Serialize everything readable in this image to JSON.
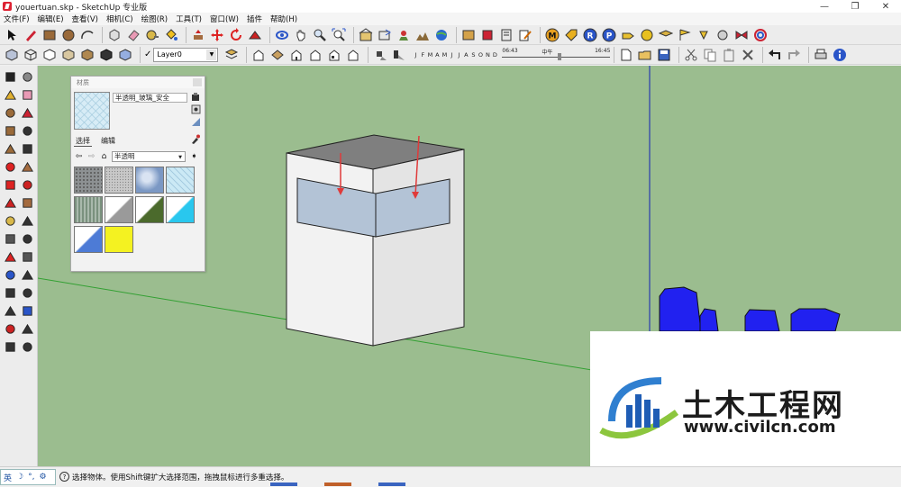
{
  "window": {
    "title": "youertuan.skp - SketchUp 专业版",
    "minimize": "—",
    "maximize": "❐",
    "close": "✕"
  },
  "menu": [
    "文件(F)",
    "编辑(E)",
    "查看(V)",
    "相机(C)",
    "绘图(R)",
    "工具(T)",
    "窗口(W)",
    "插件",
    "帮助(H)"
  ],
  "layers": {
    "check": "✓",
    "current": "Layer0"
  },
  "shadow": {
    "months": [
      "J",
      "F",
      "M",
      "A",
      "M",
      "J",
      "J",
      "A",
      "S",
      "O",
      "N",
      "D"
    ],
    "time_start": "06:43",
    "time_mid": "中午",
    "time_end": "16:45"
  },
  "materials": {
    "panel_title": "材质",
    "name": "半透明_玻璃_安全",
    "tabs": [
      "选择",
      "编辑"
    ],
    "active_tab": "选择",
    "library": "半透明",
    "swatches": [
      {
        "name": "swatch-gray-granite",
        "color": "#8d9193"
      },
      {
        "name": "swatch-speckled-stone",
        "color": "#c8c8c8"
      },
      {
        "name": "swatch-blue-sky",
        "color": "#7b98c4"
      },
      {
        "name": "swatch-clear-glass",
        "color": "#cbe9f5"
      },
      {
        "name": "swatch-green-striped",
        "color": "#7a917e"
      },
      {
        "name": "swatch-gray-split",
        "color": "#9a9a9a"
      },
      {
        "name": "swatch-green-split",
        "color": "#4b6a2c"
      },
      {
        "name": "swatch-cyan-split",
        "color": "#29c7ee"
      },
      {
        "name": "swatch-blue-split",
        "color": "#4d7bd6"
      },
      {
        "name": "swatch-yellow",
        "color": "#f4f221"
      }
    ]
  },
  "status": {
    "ime": [
      "英",
      "☽",
      "°,",
      "⚙"
    ],
    "help": "?",
    "message": "选择物体。使用Shift键扩大选择范围，拖拽鼠标进行多重选择。"
  },
  "watermark": {
    "brand": "土木工程网",
    "url": "www.civilcn.com"
  },
  "colors": {
    "viewport": "#9bbd8f",
    "glass": "#b3c3d6",
    "arrow": "#e03a3a",
    "blue_objects": "#2121f0",
    "axis_green": "#33a033",
    "axis_blue": "#2a3cb0"
  }
}
